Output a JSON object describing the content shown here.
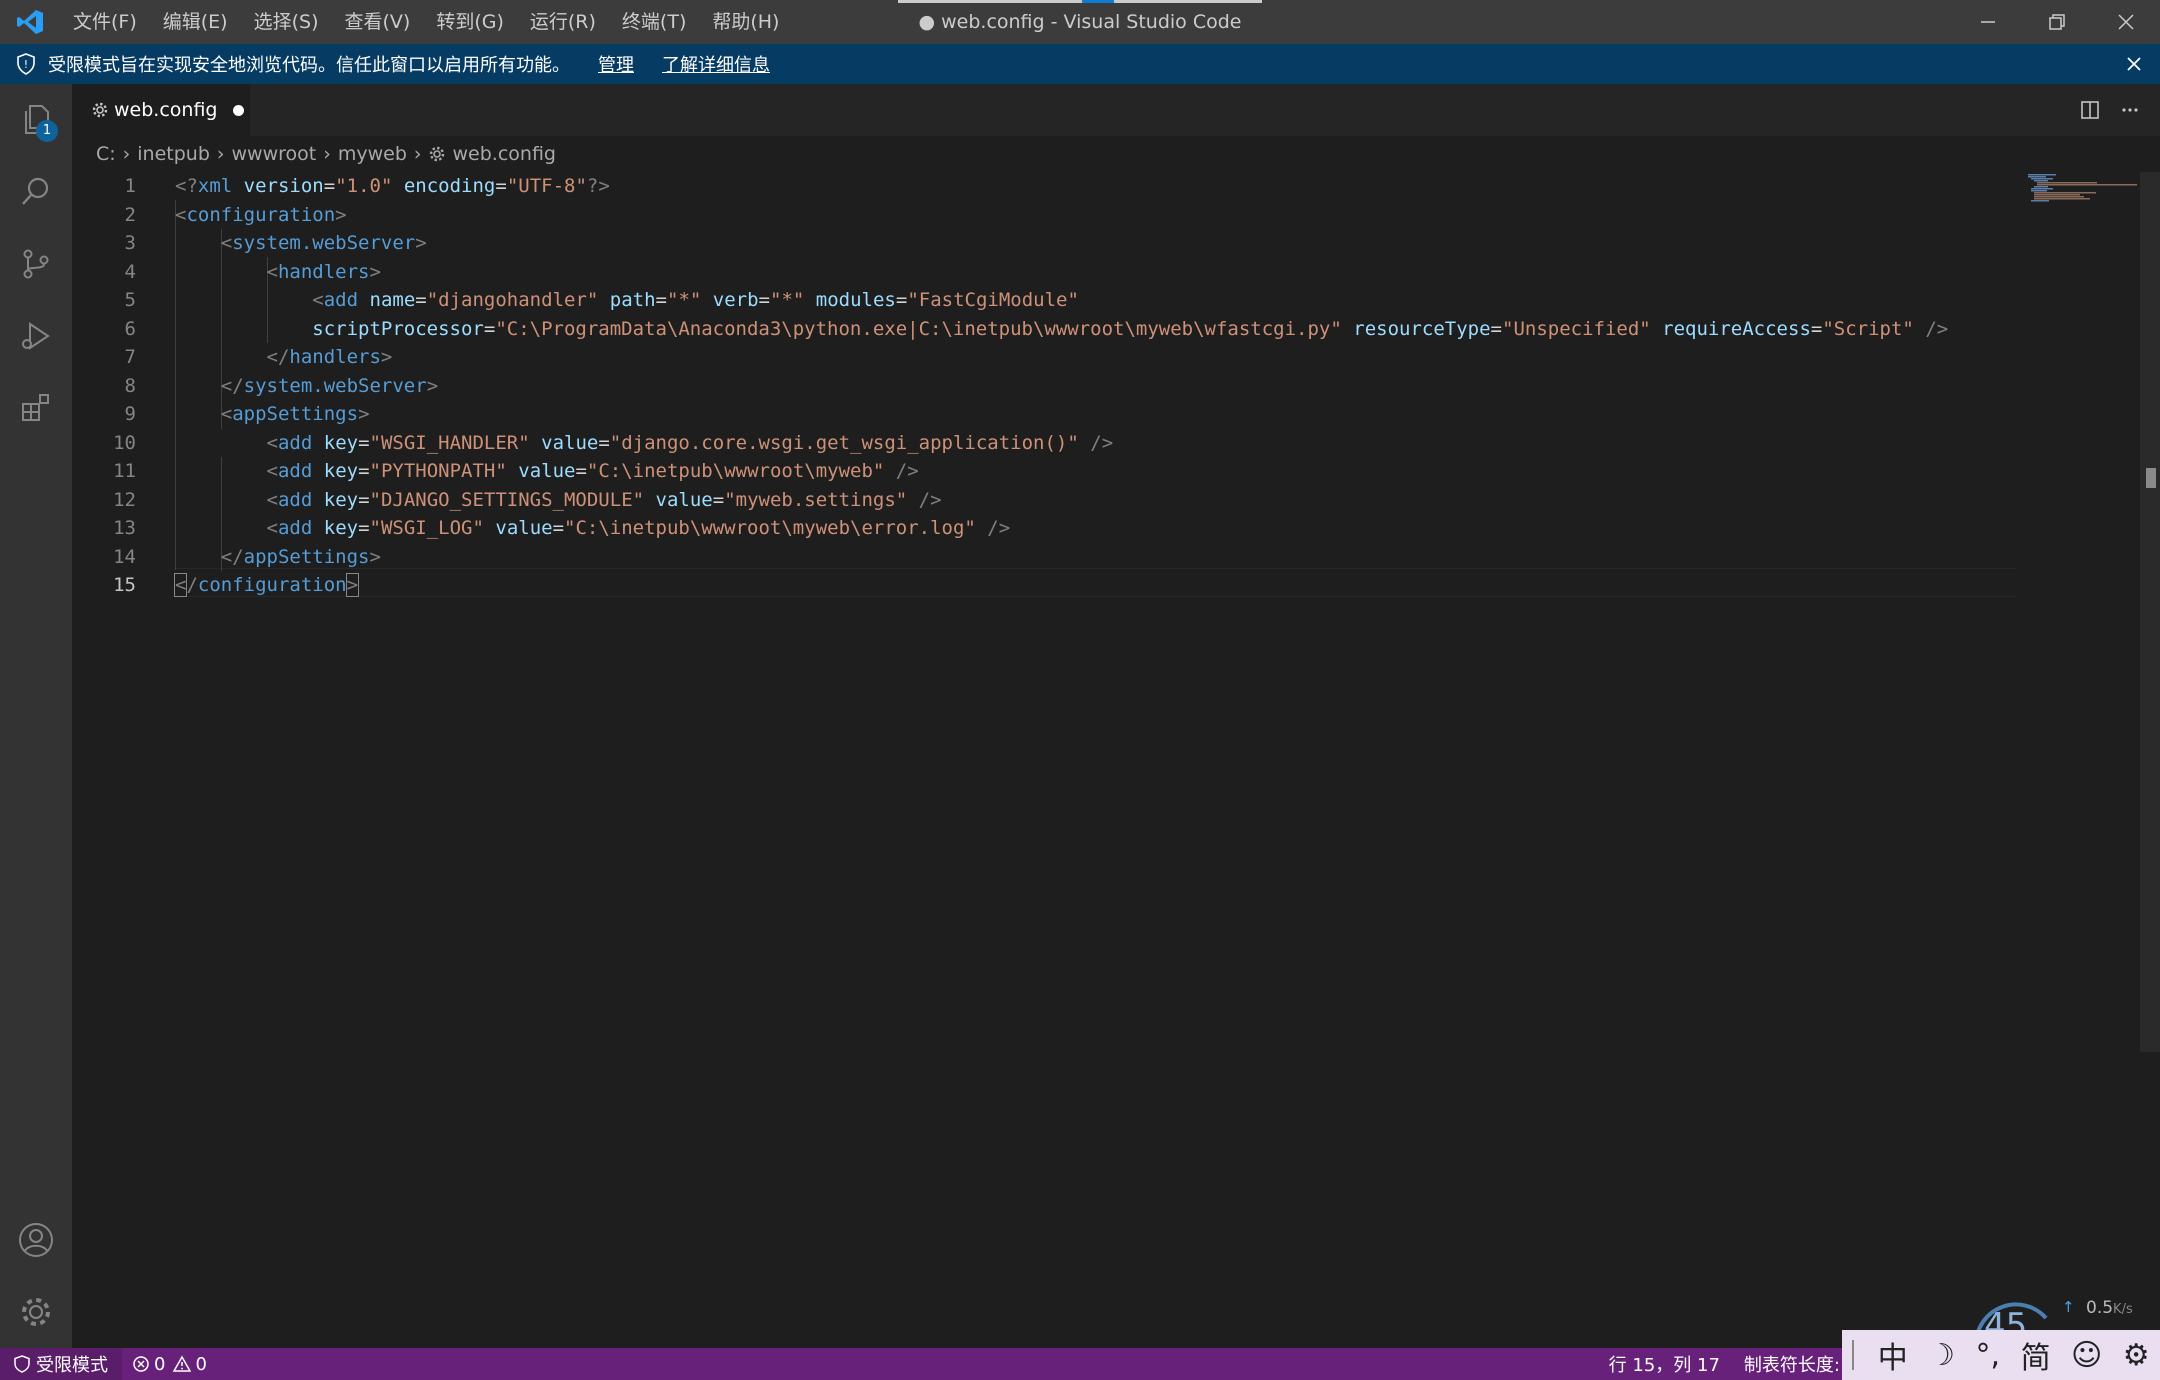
{
  "window": {
    "title": "● web.config - Visual Studio Code"
  },
  "menu": [
    "文件(F)",
    "编辑(E)",
    "选择(S)",
    "查看(V)",
    "转到(G)",
    "运行(R)",
    "终端(T)",
    "帮助(H)"
  ],
  "banner": {
    "message": "受限模式旨在实现安全地浏览代码。信任此窗口以启用所有功能。",
    "manage_link": "管理",
    "learn_more_link": "了解详细信息"
  },
  "activity": {
    "explorer_badge": "1"
  },
  "tab": {
    "label": "web.config"
  },
  "breadcrumb": [
    "C:",
    "inetpub",
    "wwwroot",
    "myweb",
    "web.config"
  ],
  "editor": {
    "line_numbers": [
      "1",
      "2",
      "3",
      "4",
      "5",
      "6",
      "7",
      "8",
      "9",
      "10",
      "11",
      "12",
      "13",
      "14",
      "15"
    ],
    "current_line": 15
  },
  "statusbar": {
    "restricted": "受限模式",
    "errors": "0",
    "warnings": "0",
    "position": "行 15，列 17",
    "tab_size": "制表符长度:"
  },
  "ime": {
    "mode": "中",
    "punct": "°,",
    "variant": "简"
  },
  "net": {
    "cpu": "45",
    "speed": "0.5",
    "unit": "K/s"
  }
}
